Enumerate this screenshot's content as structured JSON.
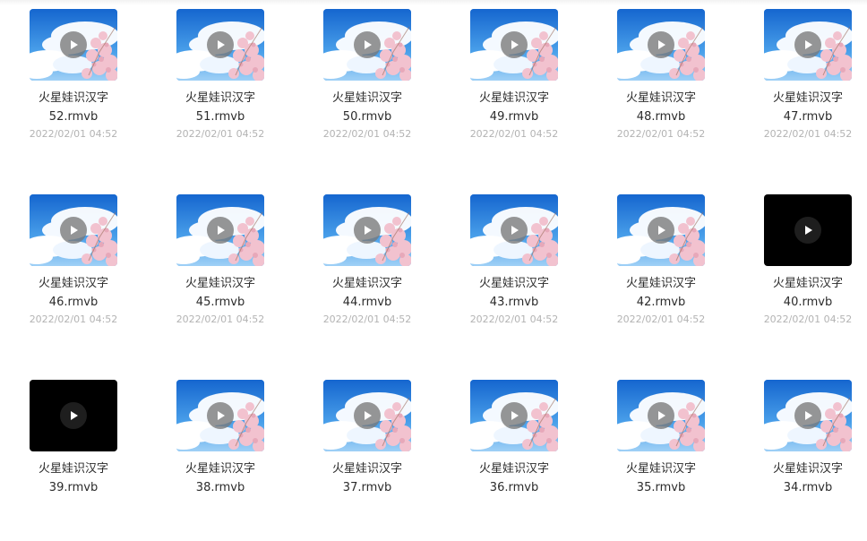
{
  "files": [
    {
      "title": "火星娃识汉字",
      "ext": "52.rmvb",
      "date": "2022/02/01 04:52",
      "thumb": "sky"
    },
    {
      "title": "火星娃识汉字",
      "ext": "51.rmvb",
      "date": "2022/02/01 04:52",
      "thumb": "sky"
    },
    {
      "title": "火星娃识汉字",
      "ext": "50.rmvb",
      "date": "2022/02/01 04:52",
      "thumb": "sky"
    },
    {
      "title": "火星娃识汉字",
      "ext": "49.rmvb",
      "date": "2022/02/01 04:52",
      "thumb": "sky"
    },
    {
      "title": "火星娃识汉字",
      "ext": "48.rmvb",
      "date": "2022/02/01 04:52",
      "thumb": "sky"
    },
    {
      "title": "火星娃识汉字",
      "ext": "47.rmvb",
      "date": "2022/02/01 04:52",
      "thumb": "sky"
    },
    {
      "title": "火星娃识汉字",
      "ext": "46.rmvb",
      "date": "2022/02/01 04:52",
      "thumb": "sky"
    },
    {
      "title": "火星娃识汉字",
      "ext": "45.rmvb",
      "date": "2022/02/01 04:52",
      "thumb": "sky"
    },
    {
      "title": "火星娃识汉字",
      "ext": "44.rmvb",
      "date": "2022/02/01 04:52",
      "thumb": "sky"
    },
    {
      "title": "火星娃识汉字",
      "ext": "43.rmvb",
      "date": "2022/02/01 04:52",
      "thumb": "sky"
    },
    {
      "title": "火星娃识汉字",
      "ext": "42.rmvb",
      "date": "2022/02/01 04:52",
      "thumb": "sky"
    },
    {
      "title": "火星娃识汉字",
      "ext": "40.rmvb",
      "date": "2022/02/01 04:52",
      "thumb": "dark"
    },
    {
      "title": "火星娃识汉字",
      "ext": "39.rmvb",
      "date": "",
      "thumb": "dark"
    },
    {
      "title": "火星娃识汉字",
      "ext": "38.rmvb",
      "date": "",
      "thumb": "sky"
    },
    {
      "title": "火星娃识汉字",
      "ext": "37.rmvb",
      "date": "",
      "thumb": "sky"
    },
    {
      "title": "火星娃识汉字",
      "ext": "36.rmvb",
      "date": "",
      "thumb": "sky"
    },
    {
      "title": "火星娃识汉字",
      "ext": "35.rmvb",
      "date": "",
      "thumb": "sky"
    },
    {
      "title": "火星娃识汉字",
      "ext": "34.rmvb",
      "date": "",
      "thumb": "sky"
    }
  ],
  "icons": {
    "play": "play-icon"
  },
  "colors": {
    "sky_top": "#1a72d6",
    "sky_bottom": "#6bb6f0",
    "cloud": "#ffffff",
    "blossom": "#f3c4d0",
    "dark_thumb": "#000000"
  }
}
